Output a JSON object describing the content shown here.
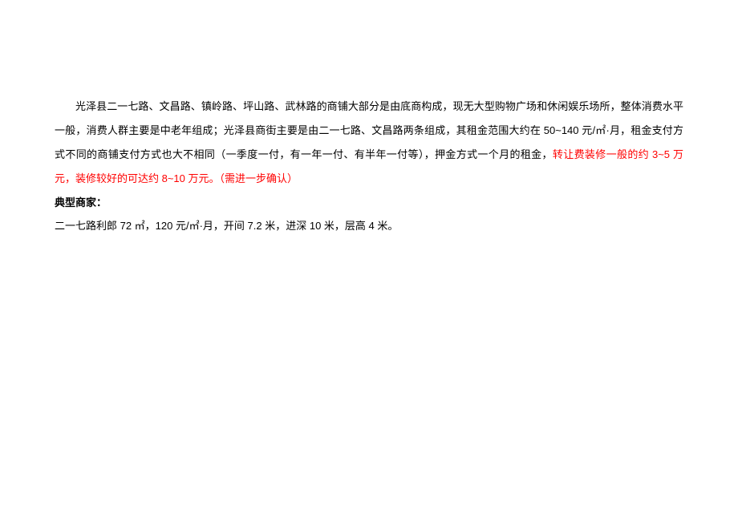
{
  "paragraph1": {
    "part1": "光泽县二一七路、文昌路、镇岭路、坪山路、武林路的商铺大部分是由底商构成，现无大型购物广场和休闲娱乐场所，整体消费水平一般，消费人群主要是中老年组成；光泽县商街主要是由二一七路、文昌路两条组成，其租金范围大约在 50~140 元/㎡·月，租金支付方式不同的商铺支付方式也大不相同（一季度一付，有一年一付、有半年一付等），押金方式一个月的租金，",
    "part2_red": "转让费装修一般的约 3~5 万元，装修较好的可达约 8~10 万元。（需进一步确认）"
  },
  "heading": "典型商家：",
  "paragraph2": "二一七路利郎 72 ㎡，120 元/㎡·月，开间 7.2 米，进深 10 米，层高 4 米。"
}
